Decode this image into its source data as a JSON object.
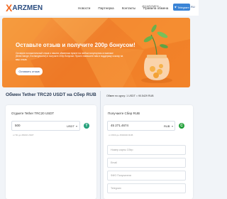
{
  "logo": {
    "mark": "X",
    "text": "ARZMEN"
  },
  "nav": {
    "items": [
      "Новости",
      "Партнерка",
      "Контакты",
      "Правила обмена",
      "AML"
    ]
  },
  "header": {
    "contact": "@XARZMEN",
    "telegram": "Telegram",
    "lang": "RU"
  },
  "banner": {
    "title": "Оставьте отзыв и получите 200р бонусом!",
    "text": "Оставьте положительный отзыв о нашем обменном пункте на любом популярном отзывнике (BestChange, Exchangesumo) и получите 200р бонусом. Просто напишите нам в поддержку ссылку на ваш отзыв.",
    "button": "Оставить отзыв"
  },
  "exchange": {
    "title": "Обмен Tether TRC20 USDT на Сбер RUB",
    "rate": "Обмен по курсу: 1 USDT = 90.5429 RUB",
    "give": {
      "title": "Отдаете Tether TRC20 USDT",
      "amount": "500",
      "currency": "USDT",
      "coin_symbol": "T",
      "coin_color": "#26a17b",
      "hint": "от 50 до 45000 USDT"
    },
    "get": {
      "title": "Получаете Сбер RUB",
      "amount": "45 271.4674",
      "currency": "RUB",
      "coin_symbol": "С",
      "coin_color": "#21a038",
      "hint": "от 4500 до 4500000 RUB",
      "fields": [
        "Номер карты Сбер",
        "Email",
        "ФИО Получателя",
        "Telegram"
      ]
    }
  },
  "colors": {
    "accent": "#f07f2b",
    "brand": "#2b4d80",
    "button": "#3a84d6"
  }
}
